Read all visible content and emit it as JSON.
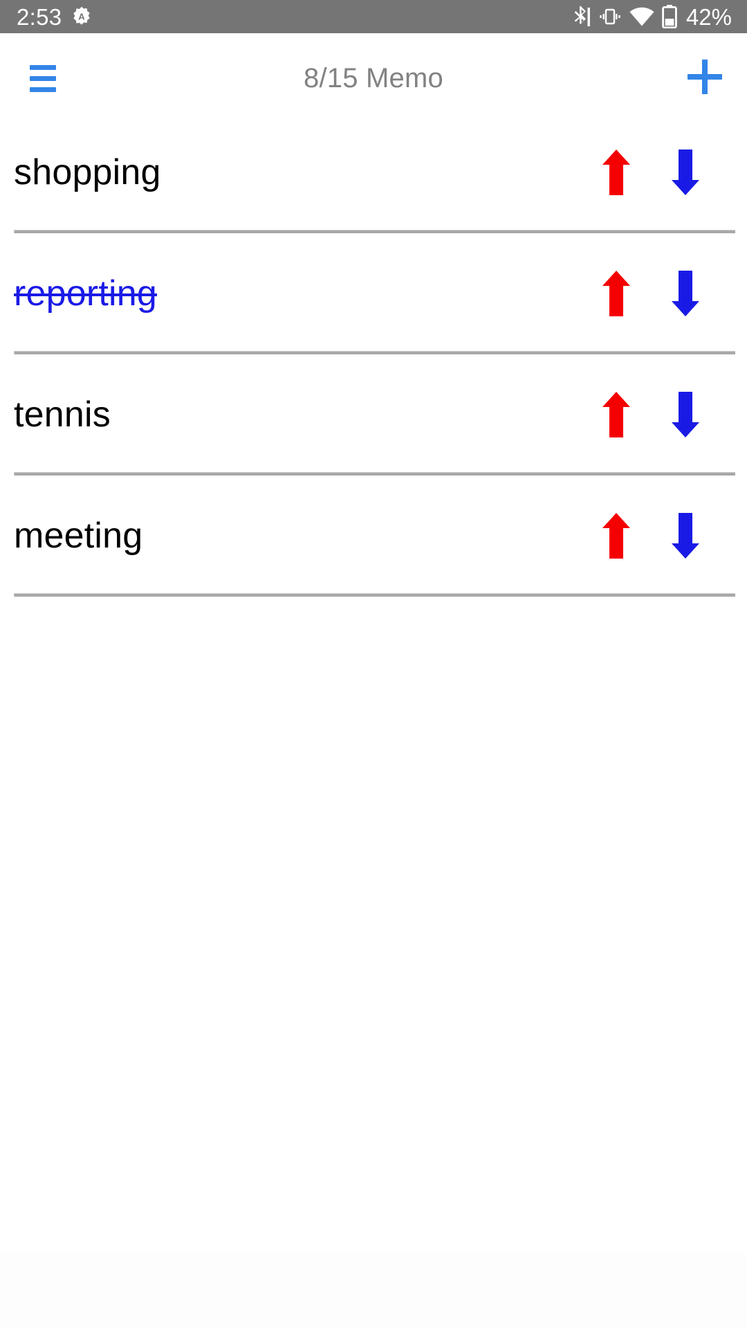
{
  "status_bar": {
    "time": "2:53",
    "alarm_icon": "alarm-badge-icon",
    "bluetooth_icon": "bluetooth-icon",
    "vibrate_icon": "vibrate-icon",
    "wifi_icon": "wifi-icon",
    "battery_icon": "battery-icon",
    "battery_text": "42%",
    "background_color": "#757575",
    "foreground_color": "#ffffff"
  },
  "header": {
    "title": "8/15 Memo",
    "menu_icon": "hamburger-menu-icon",
    "add_icon": "plus-icon",
    "accent_color": "#3385e8",
    "title_color": "#828282"
  },
  "list": {
    "move_up_icon": "arrow-up-icon",
    "move_down_icon": "arrow-down-icon",
    "up_arrow_color": "#f50000",
    "down_arrow_color": "#1a1ae6",
    "done_color": "#1a1ae6",
    "pending_color": "#000000",
    "items": [
      {
        "label": "shopping",
        "done": false
      },
      {
        "label": "reporting",
        "done": true
      },
      {
        "label": "tennis",
        "done": false
      },
      {
        "label": "meeting",
        "done": false
      }
    ]
  }
}
